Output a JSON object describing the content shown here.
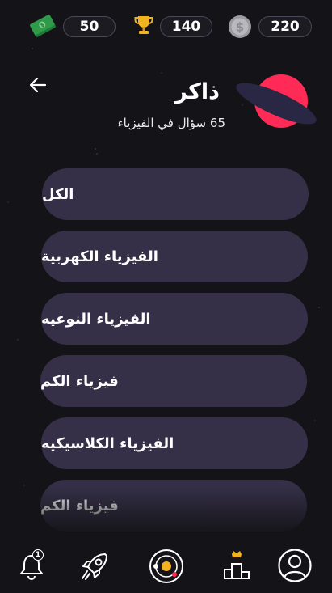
{
  "stats": {
    "cash": "50",
    "trophies": "140",
    "coins": "220"
  },
  "header": {
    "title": "ذاكر",
    "subtitle": "65 سؤال في الفيزياء"
  },
  "categories": [
    "الكل",
    "الفيزياء الكهربية",
    "الفيزياء النوعيه",
    "فيزياء الكم",
    "الفيزياء الكلاسيكيه",
    "فيزياء الكم"
  ],
  "nav": {
    "notifications_badge": "1",
    "icons": [
      "bell-icon",
      "rocket-icon",
      "solar-system-icon",
      "podium-icon",
      "profile-icon"
    ]
  },
  "colors": {
    "background": "#141317",
    "button": "#353048",
    "accent_red": "#ff2a55",
    "accent_navy": "#2a2744",
    "gold": "#f3b320",
    "cash_green": "#2e9a4a"
  }
}
